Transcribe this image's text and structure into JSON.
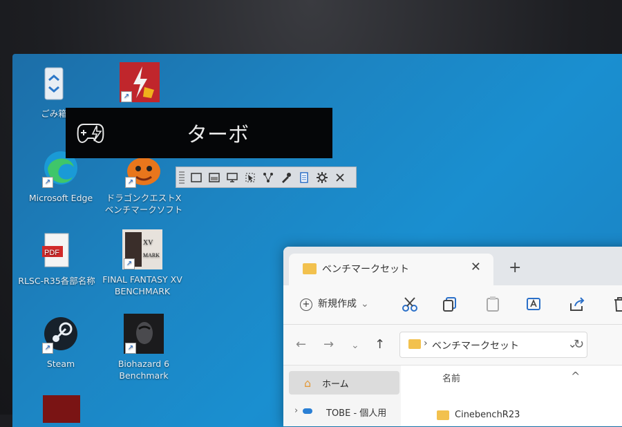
{
  "overlay": {
    "title": "ターボ",
    "icon": "gamepad-turbo-icon"
  },
  "desktop": {
    "icons": [
      {
        "label": "ごみ箱",
        "icon": "recycle-bin-icon"
      },
      {
        "label": "",
        "icon": "turbo-app-icon"
      },
      {
        "label": "Microsoft Edge",
        "icon": "edge-icon"
      },
      {
        "label": "ドラゴンクエストⅩ ベンチマークソフト",
        "icon": "dq-icon"
      },
      {
        "label": "RLSC-R35各部名称",
        "icon": "pdf-icon"
      },
      {
        "label": "FINAL FANTASY XV BENCHMARK",
        "icon": "ff-icon"
      },
      {
        "label": "Steam",
        "icon": "steam-icon"
      },
      {
        "label": "Biohazard 6 Benchmark",
        "icon": "biohazard-icon"
      }
    ]
  },
  "toolbar": {
    "items": [
      "window-icon",
      "window2-icon",
      "monitor-icon",
      "select-icon",
      "network-icon",
      "eyedropper-icon",
      "document-icon",
      "gear-icon",
      "close-icon"
    ]
  },
  "explorer": {
    "tab_title": "ベンチマークセット",
    "tab_close": "✕",
    "new_tab": "+",
    "new_label": "新規作成",
    "path": "ベンチマークセット",
    "sidebar_home": "ホーム",
    "sidebar_onedrive": "TOBE - 個人用",
    "column_name": "名前",
    "file1": "CinebenchR23"
  },
  "colors": {
    "desktop": "#1a84c4",
    "overlay": "#050608",
    "folder": "#f2c14e"
  }
}
